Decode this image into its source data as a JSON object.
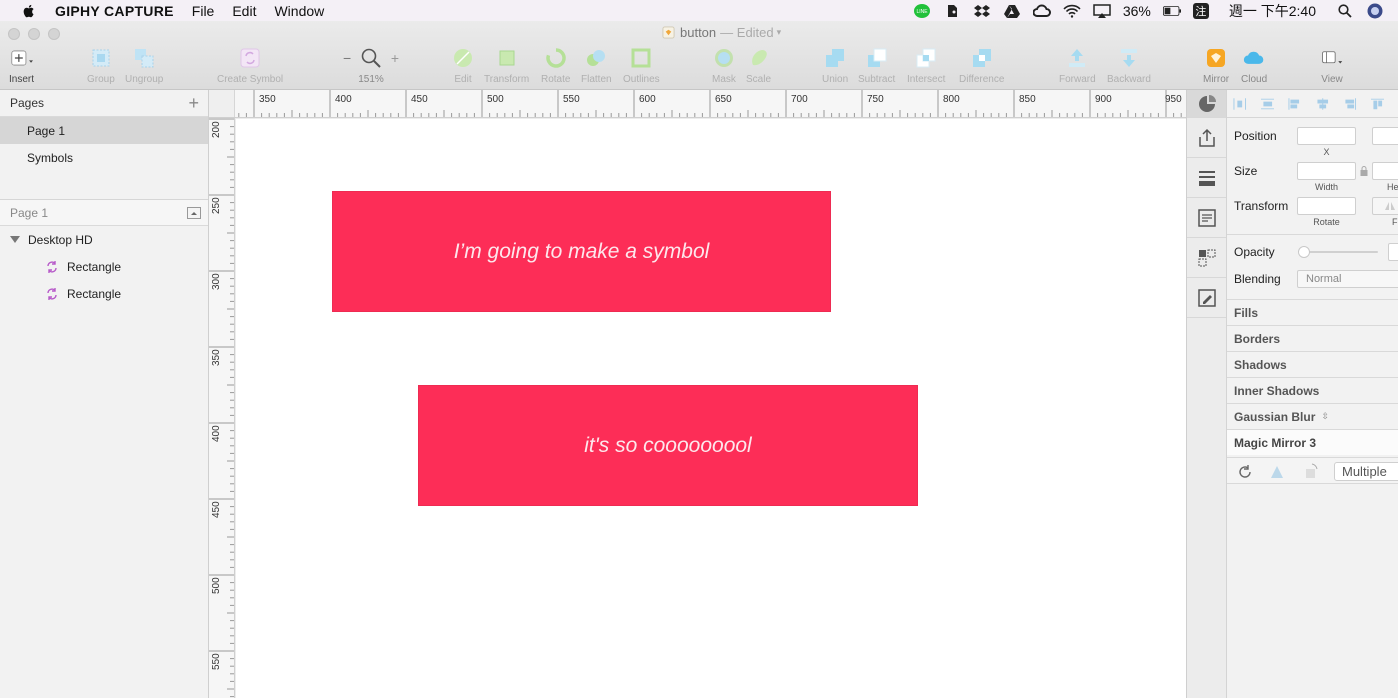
{
  "menubar": {
    "app_name": "GIPHY CAPTURE",
    "menus": [
      "File",
      "Edit",
      "Window"
    ],
    "battery": "36%",
    "input_method": "注",
    "clock": "週一 下午2:40"
  },
  "window": {
    "doc_name": "button",
    "doc_status": "— Edited"
  },
  "toolbar": {
    "insert": "Insert",
    "group": "Group",
    "ungroup": "Ungroup",
    "create_symbol": "Create Symbol",
    "zoom": "151%",
    "edit": "Edit",
    "transform": "Transform",
    "rotate": "Rotate",
    "flatten": "Flatten",
    "outlines": "Outlines",
    "mask": "Mask",
    "scale": "Scale",
    "union": "Union",
    "subtract": "Subtract",
    "intersect": "Intersect",
    "difference": "Difference",
    "forward": "Forward",
    "backward": "Backward",
    "mirror": "Mirror",
    "cloud": "Cloud",
    "view": "View"
  },
  "pages_panel": {
    "title": "Pages",
    "pages": [
      "Page 1",
      "Symbols"
    ],
    "selected_page": "Page 1"
  },
  "layers_panel": {
    "title": "Page 1",
    "artboard": "Desktop HD",
    "layers": [
      "Rectangle",
      "Rectangle"
    ]
  },
  "rulers": {
    "top_labels": [
      "350",
      "400",
      "450",
      "500",
      "550",
      "600",
      "650",
      "700",
      "750",
      "800",
      "850",
      "900",
      "950"
    ],
    "left_labels": [
      "200",
      "250",
      "300",
      "350",
      "400",
      "450",
      "500",
      "550"
    ]
  },
  "canvas": {
    "rect_color": "#fd2d57",
    "rect1_text": "I’m going to make a symbol",
    "rect2_text": "it's so cooooooool"
  },
  "inspector": {
    "position_label": "Position",
    "x_label": "X",
    "size_label": "Size",
    "width_label": "Width",
    "height_label": "He",
    "transform_label": "Transform",
    "rotate_label": "Rotate",
    "flip_label": "F",
    "opacity_label": "Opacity",
    "blending_label": "Blending",
    "blending_value": "Normal",
    "sections": [
      "Fills",
      "Borders",
      "Shadows",
      "Inner Shadows",
      "Gaussian Blur"
    ],
    "plugin_title": "Magic Mirror 3",
    "multiple_label": "Multiple"
  }
}
